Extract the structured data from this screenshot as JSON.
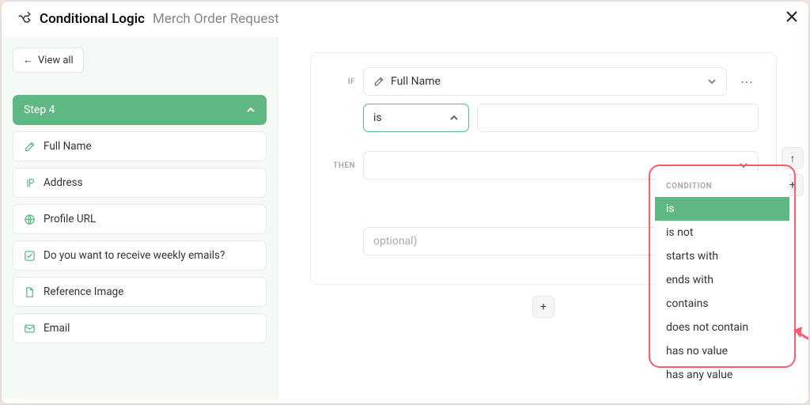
{
  "header": {
    "title": "Conditional Logic",
    "subtitle": "Merch Order Request",
    "view_all_label": "View all"
  },
  "sidebar": {
    "step_header": "Step 4",
    "items": [
      {
        "label": "Full Name",
        "icon": "edit-icon"
      },
      {
        "label": "Address",
        "icon": "paragraph-icon"
      },
      {
        "label": "Profile URL",
        "icon": "globe-icon"
      },
      {
        "label": "Do you want to receive weekly emails?",
        "icon": "check-icon"
      },
      {
        "label": "Reference Image",
        "icon": "file-icon"
      },
      {
        "label": "Email",
        "icon": "mail-icon"
      }
    ]
  },
  "rule": {
    "if_label": "IF",
    "then_label": "THEN",
    "field_selected": "Full Name",
    "condition_selected": "is",
    "optional_placeholder": "optional)"
  },
  "dropdown": {
    "header": "CONDITION",
    "items": [
      "is",
      "is not",
      "starts with",
      "ends with",
      "contains",
      "does not contain",
      "has no value",
      "has any value"
    ],
    "active_index": 0
  }
}
